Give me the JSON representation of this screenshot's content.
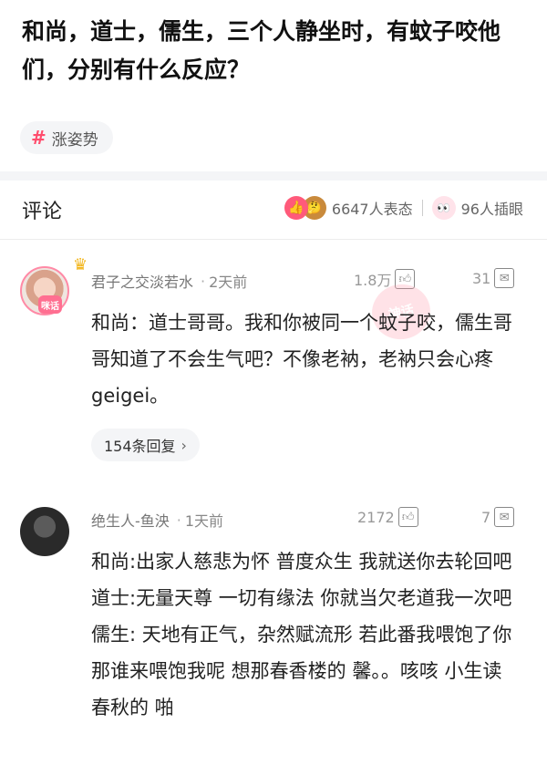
{
  "question": {
    "title": "和尚，道士，儒生，三个人静坐时，有蚊子咬他们，分别有什么反应？"
  },
  "tag": {
    "symbol": "#",
    "label": "涨姿势"
  },
  "comments_header": {
    "title": "评论",
    "reactions_count": "6647人表态",
    "eyes_count": "96人插眼"
  },
  "comments": [
    {
      "user": "君子之交淡若水",
      "avatar_badge": "咪话",
      "time": "2天前",
      "likes": "1.8万",
      "replies_count": "31",
      "text": "和尚：道士哥哥。我和你被同一个蚊子咬，儒生哥哥知道了不会生气吧？不像老衲，老衲只会心疼geigei。",
      "reply_link": "154条回复",
      "reply_chevron": "›",
      "stamp": "神话"
    },
    {
      "user": "绝生人-鱼泱",
      "time": "1天前",
      "likes": "2172",
      "replies_count": "7",
      "text": "和尚:出家人慈悲为怀 普度众生 我就送你去轮回吧 道士:无量天尊 一切有缘法 你就当欠老道我一次吧 儒生: 天地有正气，杂然赋流形 若此番我喂饱了你 那谁来喂饱我呢 想那春香楼的 馨。。咳咳 小生读春秋的 啪"
    }
  ],
  "colors": {
    "accent": "#ff4d6d",
    "divider": "#f4f5f7"
  }
}
